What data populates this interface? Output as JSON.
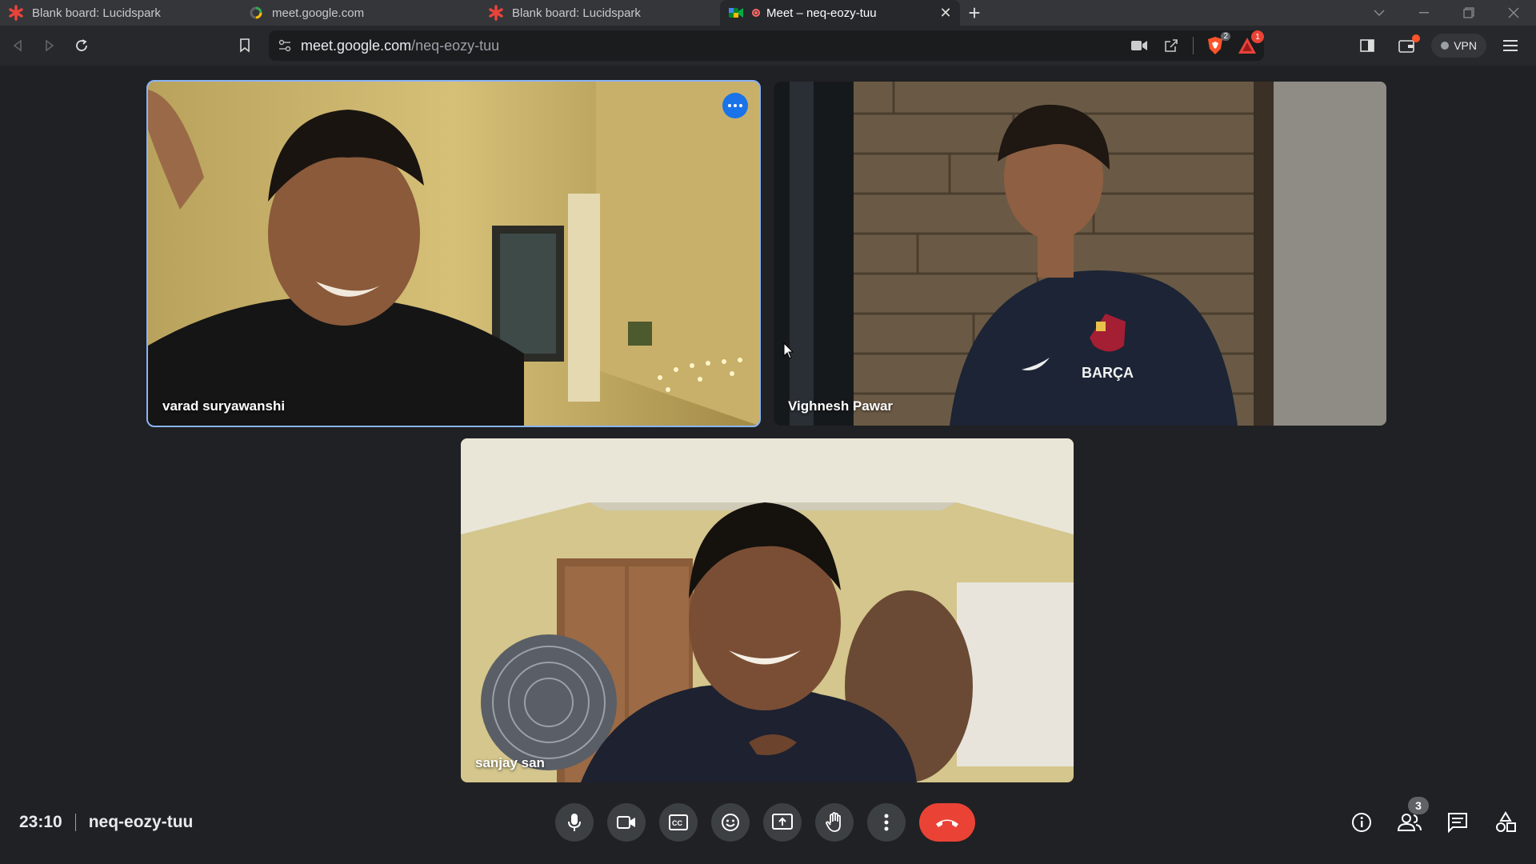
{
  "browser": {
    "tabs": [
      {
        "title": "Blank board: Lucidspark",
        "icon": "lucidspark-icon",
        "active": false
      },
      {
        "title": "meet.google.com",
        "icon": "loading-icon",
        "active": false
      },
      {
        "title": "Blank board: Lucidspark",
        "icon": "lucidspark-icon",
        "active": false
      },
      {
        "title": "Meet – neq-eozy-tuu",
        "icon": "google-meet-icon",
        "active": true
      }
    ],
    "new_tab_label": "+",
    "url_host": "meet.google.com",
    "url_path": "/neq-eozy-tuu",
    "brave_badge": "2",
    "alert_badge": "1",
    "vpn_label": "VPN"
  },
  "meeting": {
    "participants": [
      {
        "name": "varad suryawanshi",
        "speaking": true
      },
      {
        "name": "Vighnesh Pawar",
        "speaking": false
      },
      {
        "name": "sanjay san",
        "speaking": false
      }
    ],
    "time": "23:10",
    "code": "neq-eozy-tuu",
    "people_count": "3"
  },
  "colors": {
    "background": "#202124",
    "control": "#3c4043",
    "hangup": "#ea4335",
    "speaking_outline": "#8ab4f8",
    "more_button": "#1a73e8"
  }
}
